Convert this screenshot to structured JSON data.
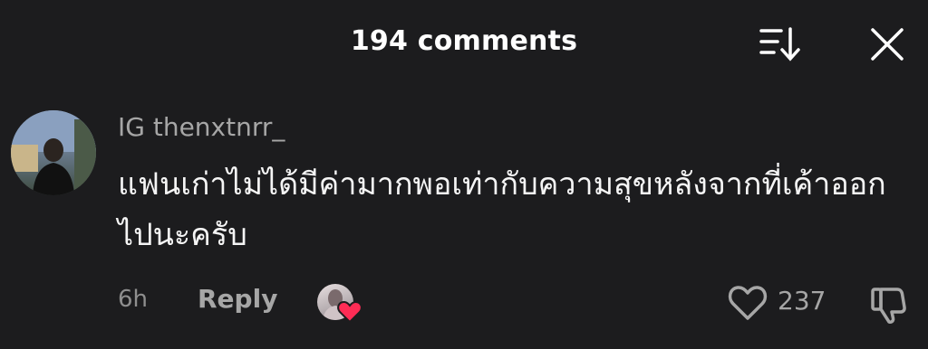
{
  "header": {
    "title": "194 comments"
  },
  "icons": {
    "sort": "sort-icon",
    "close": "close-icon",
    "like": "heart-outline-icon",
    "dislike": "thumbs-down-icon",
    "creator_heart": "heart-filled-icon"
  },
  "colors": {
    "background": "#1c1c1e",
    "text_primary": "#f5f5f5",
    "text_secondary": "#a6a6a6",
    "heart_red": "#fe2c55"
  },
  "comment": {
    "username": "IG thenxtnrr_",
    "text": "แฟนเก่าไม่ได้มีค่ามากพอเท่ากับความสุขหลังจากที่เค้าออกไปนะครับ",
    "time": "6h",
    "reply_label": "Reply",
    "like_count": "237",
    "liked_by_creator": true
  }
}
